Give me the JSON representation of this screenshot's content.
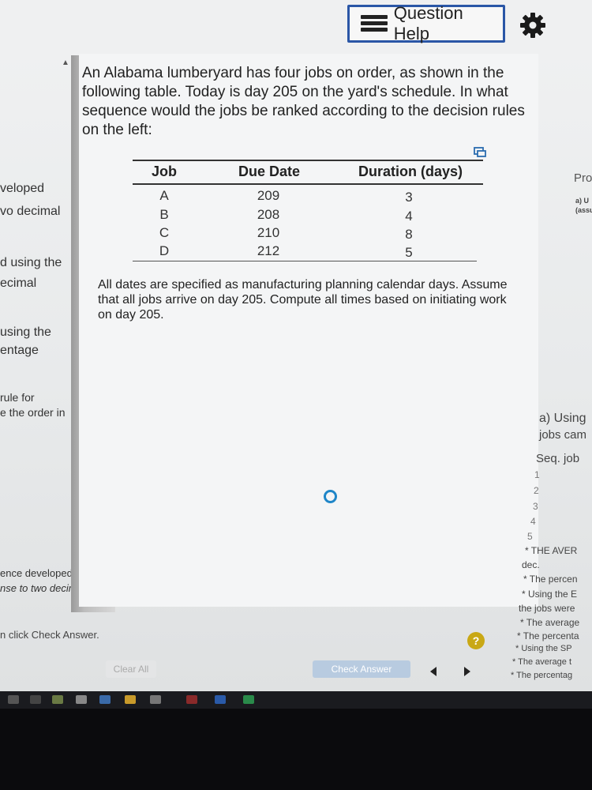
{
  "header": {
    "question_help_label": "Question Help"
  },
  "left_panel": {
    "lines": [
      "veloped",
      "vo decimal",
      "d using the",
      "ecimal",
      "using the",
      "entage",
      "rule for",
      "e the order in",
      "ence developed",
      "nse to two decimal"
    ]
  },
  "question": {
    "text": "An Alabama lumberyard has four jobs on order, as shown in the following table. Today is day 205 on the yard's schedule. In what sequence would the jobs be ranked according to the decision rules on the left:",
    "table": {
      "headers": [
        "Job",
        "Due Date",
        "Duration (days)"
      ],
      "rows": [
        [
          "A",
          "209",
          "3"
        ],
        [
          "B",
          "208",
          "4"
        ],
        [
          "C",
          "210",
          "8"
        ],
        [
          "D",
          "212",
          "5"
        ]
      ]
    },
    "note": "All dates are specified as manufacturing planning calendar days. Assume that all jobs arrive on day 205. Compute all times based on initiating work on day 205."
  },
  "right_panel": {
    "pro": "Pro",
    "sub1": "a) U",
    "sub2": "(assu",
    "a_using": "a) Using",
    "jobs_cam": "jobs cam",
    "seq_job": "Seq. job",
    "seq": [
      "1",
      "2",
      "3",
      "4",
      "5"
    ],
    "bullets": [
      "* THE AVER",
      "dec.",
      "* The percen",
      "* Using the E",
      "the jobs were",
      "* The average",
      "* The percenta",
      "* Using the SP",
      "* The average t",
      "* The percentag"
    ]
  },
  "footer": {
    "instruction": "n click Check Answer.",
    "help_symbol": "?",
    "clear_all": "Clear All",
    "check_answer": "Check Answer"
  },
  "colors": {
    "accent_border": "#2a56a6",
    "progress_ring": "#1f86c8",
    "help_badge": "#c9a815"
  }
}
